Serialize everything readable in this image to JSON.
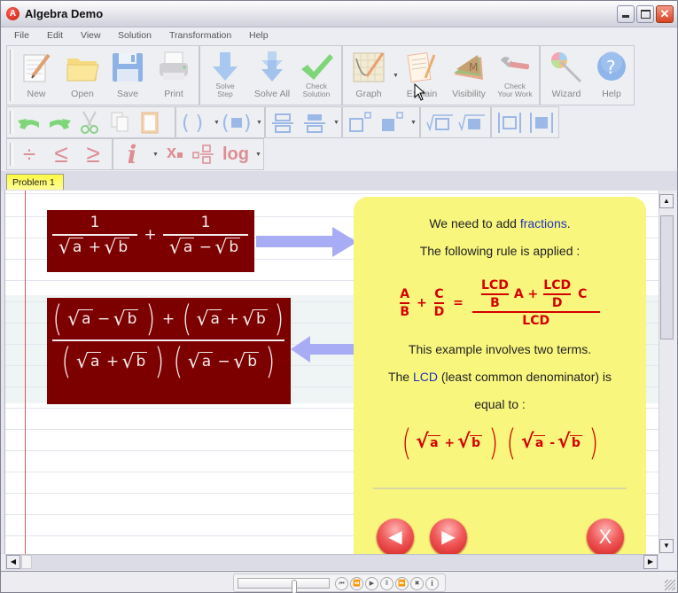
{
  "window": {
    "title": "Algebra Demo",
    "app_icon_letter": "A",
    "controls": {
      "minimize": "minimize",
      "maximize": "maximize",
      "close": "✕"
    }
  },
  "menu": [
    "File",
    "Edit",
    "View",
    "Solution",
    "Transformation",
    "Help"
  ],
  "toolbar_main": {
    "file_group": [
      {
        "label": "New",
        "icon": "new-document-icon"
      },
      {
        "label": "Open",
        "icon": "folder-icon"
      },
      {
        "label": "Save",
        "icon": "floppy-disk-icon"
      },
      {
        "label": "Print",
        "icon": "printer-icon"
      }
    ],
    "solve_group": [
      {
        "label": "Solve\nStep",
        "line1": "Solve",
        "line2": "Step",
        "icon": "arrow-down-icon"
      },
      {
        "label": "Solve All",
        "icon": "double-arrow-down-icon"
      },
      {
        "label": "Check\nSolution",
        "line1": "Check",
        "line2": "Solution",
        "icon": "checkmark-icon"
      }
    ],
    "view_group": [
      {
        "label": "Graph",
        "icon": "graph-icon",
        "has_dropdown": true
      },
      {
        "label": "Explain",
        "icon": "explain-notepad-icon"
      },
      {
        "label": "Visibility",
        "icon": "visibility-layers-icon",
        "glyph": "M"
      },
      {
        "label": "Check\nYour Work",
        "line1": "Check",
        "line2": "Your Work",
        "icon": "wrench-icon"
      }
    ],
    "help_group": [
      {
        "label": "Wizard",
        "icon": "wizard-wand-icon"
      },
      {
        "label": "Help",
        "icon": "help-icon",
        "glyph": "?"
      }
    ]
  },
  "toolbar_edit": {
    "items": [
      "undo",
      "redo",
      "cut",
      "copy",
      "paste",
      "parentheses",
      "parentheses-box",
      "fraction-empty",
      "fraction-filled",
      "power-empty",
      "power-filled",
      "nth-root-empty",
      "nth-root-filled",
      "absolute-empty",
      "absolute-filled"
    ]
  },
  "toolbar_operators": {
    "items": [
      {
        "name": "divide",
        "glyph": "÷"
      },
      {
        "name": "less-or-equal",
        "glyph": "≤"
      },
      {
        "name": "greater-or-equal",
        "glyph": "≥"
      },
      {
        "name": "imaginary",
        "glyph": "i"
      },
      {
        "name": "subscript",
        "glyph": "x"
      },
      {
        "name": "mixed-fraction",
        "glyph": ""
      },
      {
        "name": "log",
        "glyph": "log"
      }
    ]
  },
  "tabs": [
    {
      "label": "Problem 1",
      "active": true
    }
  ],
  "worksheet": {
    "expression_1": {
      "term1": {
        "numerator": "1",
        "denominator": [
          "a",
          "+",
          "b"
        ]
      },
      "operator": "+",
      "term2": {
        "numerator": "1",
        "denominator": [
          "a",
          "−",
          "b"
        ]
      }
    },
    "expression_2": {
      "numerator": {
        "left": [
          "a",
          "−",
          "b"
        ],
        "operator": "+",
        "right": [
          "a",
          "+",
          "b"
        ]
      },
      "denominator": {
        "left": [
          "a",
          "+",
          "b"
        ],
        "right": [
          "a",
          "−",
          "b"
        ]
      }
    }
  },
  "explain_panel": {
    "line1_prefix": "We need to add ",
    "line1_link": "fractions",
    "line1_suffix": ".",
    "line2": "The following rule is applied :",
    "rule": {
      "lhs1_num": "A",
      "lhs1_den": "B",
      "plus": "+",
      "lhs2_num": "C",
      "lhs2_den": "D",
      "equals": "=",
      "rhs_num_f1_num": "LCD",
      "rhs_num_f1_den": "B",
      "rhs_num_mult1": "A +",
      "rhs_num_f2_num": "LCD",
      "rhs_num_f2_den": "D",
      "rhs_num_mult2": "C",
      "rhs_den": "LCD"
    },
    "line3": "This example involves two terms.",
    "line4_prefix": "The ",
    "line4_link": "LCD",
    "line4_suffix": " (least common denominator) is",
    "line5": "equal to :",
    "lcd": {
      "left": [
        "a",
        "+",
        "b"
      ],
      "right": [
        "a",
        "-",
        "b"
      ]
    },
    "buttons": {
      "prev": "◀",
      "next": "▶",
      "close": "X"
    }
  },
  "player": {
    "slider_position": 0.63,
    "controls": [
      {
        "name": "first",
        "glyph": "⏮"
      },
      {
        "name": "rewind",
        "glyph": "⏪"
      },
      {
        "name": "play",
        "glyph": "▶"
      },
      {
        "name": "pause",
        "glyph": "‖"
      },
      {
        "name": "fast-forward",
        "glyph": "⏩"
      },
      {
        "name": "stop",
        "glyph": "✖"
      },
      {
        "name": "info",
        "glyph": "i"
      }
    ]
  },
  "colors": {
    "expression_bg": "#7c0000",
    "panel_bg": "#f8f67d",
    "rule_red": "#d40000",
    "link_blue": "#2233bb",
    "arrow_blue": "#a8acf4",
    "tab_yellow": "#fffa40",
    "margin_red": "#d9535a"
  }
}
